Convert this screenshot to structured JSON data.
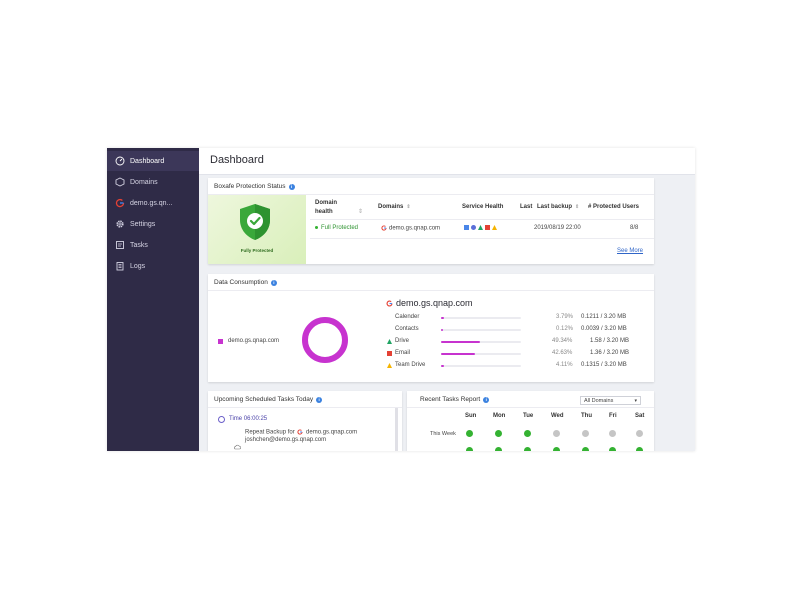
{
  "sidebar": {
    "items": [
      {
        "label": "Dashboard",
        "icon": "dashboard-icon",
        "active": true
      },
      {
        "label": "Domains",
        "icon": "domains-icon"
      },
      {
        "label": "demo.gs.qn...",
        "icon": "google-icon"
      },
      {
        "label": "Settings",
        "icon": "gear-icon"
      },
      {
        "label": "Tasks",
        "icon": "tasks-icon"
      },
      {
        "label": "Logs",
        "icon": "logs-icon"
      }
    ]
  },
  "header": {
    "title": "Dashboard"
  },
  "protection": {
    "title": "Boxafe Protection Status",
    "badge_label": "Fully Protected",
    "columns": {
      "domain_health_line1": "Domain",
      "domain_health_line2": "health",
      "domains": "Domains",
      "service_health": "Service Health",
      "last": "Last",
      "last_backup": "Last backup",
      "protected_users": "# Protected Users"
    },
    "row": {
      "domain_health": "Full Protected",
      "domain": "demo.gs.qnap.com",
      "last_backup": "2019/08/19 22:00",
      "protected_users": "8/8"
    },
    "see_more": "See More"
  },
  "consumption": {
    "title": "Data Consumption",
    "legend_label": "demo.gs.qnap.com",
    "domain_title": "demo.gs.qnap.com",
    "services": [
      {
        "name": "Calender",
        "percent_label": "3.79%",
        "size": "0.1211 / 3.20 MB",
        "percent": 3.79
      },
      {
        "name": "Contacts",
        "percent_label": "0.12%",
        "size": "0.0039 / 3.20 MB",
        "percent": 0.12
      },
      {
        "name": "Drive",
        "percent_label": "49.34%",
        "size": "1.58 / 3.20 MB",
        "percent": 49.34
      },
      {
        "name": "Email",
        "percent_label": "42.63%",
        "size": "1.36 / 3.20 MB",
        "percent": 42.63
      },
      {
        "name": "Team Drive",
        "percent_label": "4.11%",
        "size": "0.1315 / 3.20 MB",
        "percent": 4.11
      }
    ],
    "accent": "#c733cf"
  },
  "tasks_today": {
    "title": "Upcoming Scheduled Tasks Today",
    "time": "Time 06:00:25",
    "task_prefix": "Repeat Backup for",
    "task_domain": "demo.gs.qnap.com",
    "user": "joshchen@demo.gs.qnap.com"
  },
  "report": {
    "title": "Recent Tasks Report",
    "domain_filter": "All Domains",
    "days": [
      "Sun",
      "Mon",
      "Tue",
      "Wed",
      "Thu",
      "Fri",
      "Sat"
    ],
    "row_label": "This Week",
    "this_week_status": [
      "ok",
      "ok",
      "ok",
      "none",
      "none",
      "none",
      "none"
    ],
    "next_row_status": [
      "ok",
      "ok",
      "ok",
      "ok",
      "ok",
      "ok",
      "ok"
    ]
  },
  "colors": {
    "sidebar": "#2f2b47",
    "ok": "#34b232",
    "link": "#2f65c8"
  }
}
